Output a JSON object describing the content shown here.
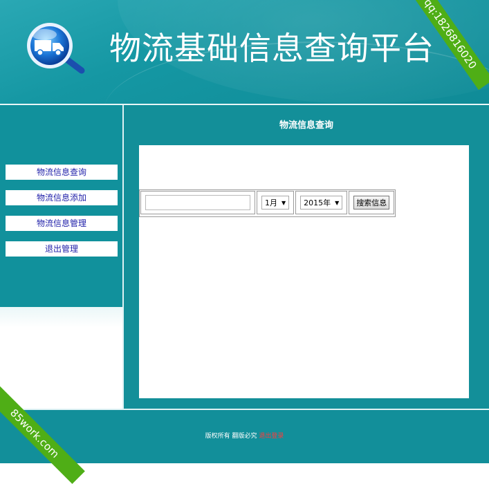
{
  "header": {
    "site_title": "物流基础信息查询平台"
  },
  "sidebar": {
    "items": [
      {
        "label": "物流信息查询"
      },
      {
        "label": "物流信息添加"
      },
      {
        "label": "物流信息管理"
      },
      {
        "label": "退出管理"
      }
    ]
  },
  "main": {
    "title": "物流信息查询",
    "search": {
      "input_value": "",
      "month": "1月",
      "year": "2015年",
      "button_label": "搜索信息"
    }
  },
  "footer": {
    "text": "版权所有 翻版必究",
    "link": "退出登录"
  },
  "watermarks": {
    "top_right": "qq:1826816020",
    "bottom_left": "85work.com"
  },
  "colors": {
    "teal": "#11919c",
    "ribbon_green": "#4fae16",
    "nav_text": "#2222aa"
  }
}
